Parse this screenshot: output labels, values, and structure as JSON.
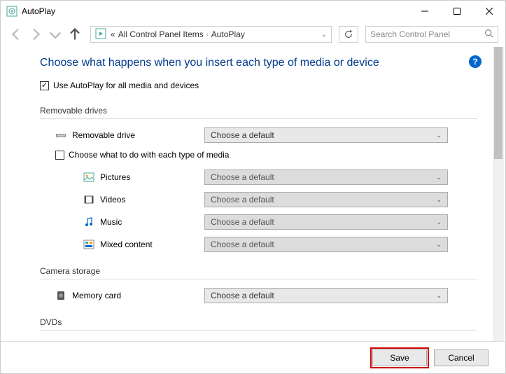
{
  "window": {
    "title": "AutoPlay"
  },
  "nav": {
    "breadcrumb": {
      "prefix": "«",
      "item1": "All Control Panel Items",
      "item2": "AutoPlay"
    },
    "search_placeholder": "Search Control Panel"
  },
  "page": {
    "heading": "Choose what happens when you insert each type of media or device",
    "use_autoplay_label": "Use AutoPlay for all media and devices",
    "choose_default": "Choose a default",
    "sections": {
      "removable": {
        "title": "Removable drives",
        "drive_label": "Removable drive",
        "sub_checkbox": "Choose what to do with each type of media",
        "pictures": "Pictures",
        "videos": "Videos",
        "music": "Music",
        "mixed": "Mixed content"
      },
      "camera": {
        "title": "Camera storage",
        "memory_card": "Memory card"
      },
      "dvds": {
        "title": "DVDs"
      }
    }
  },
  "footer": {
    "save": "Save",
    "cancel": "Cancel"
  }
}
